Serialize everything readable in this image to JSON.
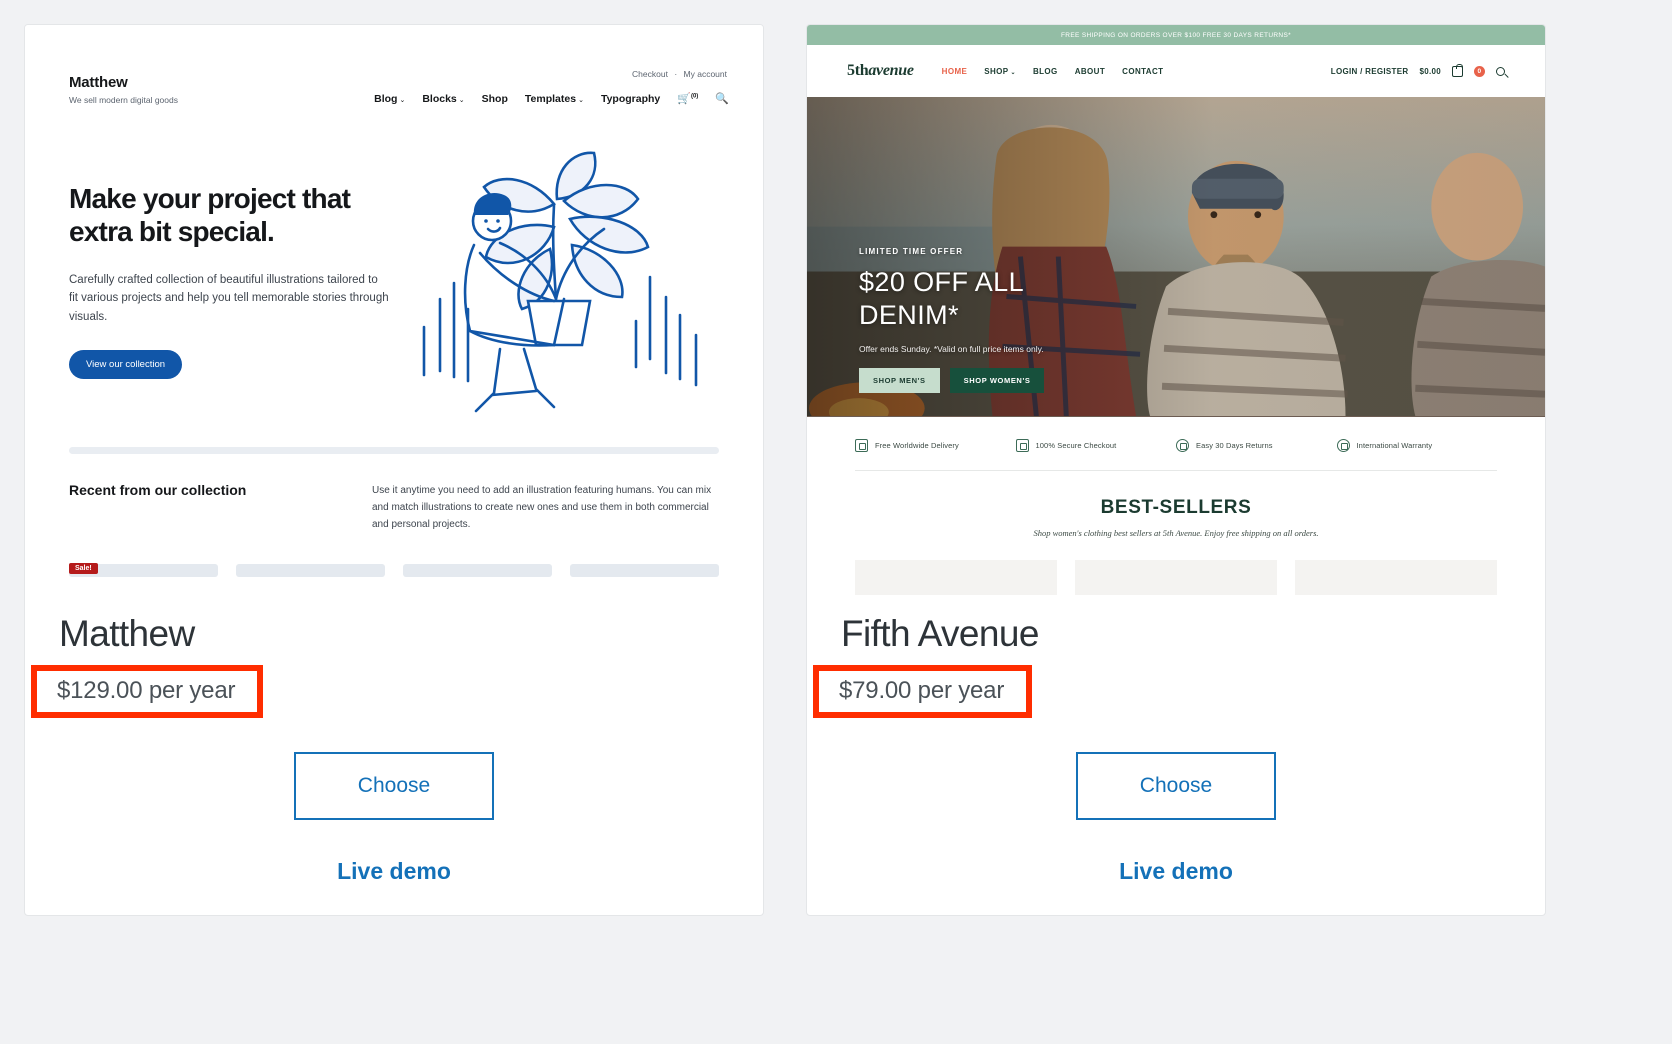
{
  "products": [
    {
      "name": "Matthew",
      "price": "$129.00 per year",
      "choose_label": "Choose",
      "demo_label": "Live demo",
      "preview": {
        "brand": "Matthew",
        "tagline": "We sell modern digital goods",
        "utility_links": [
          "Checkout",
          "My account"
        ],
        "utility_separator": "·",
        "nav": [
          {
            "label": "Blog",
            "caret": "⌄"
          },
          {
            "label": "Blocks",
            "caret": "⌄"
          },
          {
            "label": "Shop",
            "caret": ""
          },
          {
            "label": "Templates",
            "caret": "⌄"
          },
          {
            "label": "Typography",
            "caret": ""
          }
        ],
        "cart_icon": "cart-icon",
        "cart_count": "(0)",
        "search_icon": "search-icon",
        "heading": "Make your project that extra bit special.",
        "body": "Carefully crafted collection of beautiful illustrations tailored to fit various projects and help you tell memorable stories through visuals.",
        "cta": "View our collection",
        "collection_title": "Recent from our collection",
        "collection_text": "Use it anytime you need to add an illustration featuring humans. You can mix and match illustrations to create new ones and use them in both commercial and personal projects.",
        "sale_badge": "Sale!"
      }
    },
    {
      "name": "Fifth Avenue",
      "price": "$79.00 per year",
      "choose_label": "Choose",
      "demo_label": "Live demo",
      "preview": {
        "announcement": "FREE SHIPPING ON ORDERS OVER $100 FREE 30 DAYS RETURNS*",
        "logo_prefix": "5th",
        "logo_suffix": "avenue",
        "nav": [
          {
            "label": "HOME",
            "caret": "",
            "active": true
          },
          {
            "label": "SHOP",
            "caret": "⌄",
            "active": false
          },
          {
            "label": "BLOG",
            "caret": "",
            "active": false
          },
          {
            "label": "ABOUT",
            "caret": "",
            "active": false
          },
          {
            "label": "CONTACT",
            "caret": "",
            "active": false
          }
        ],
        "login": "LOGIN / REGISTER",
        "cart_total": "$0.00",
        "cart_icon": "bag-icon",
        "cart_count": "0",
        "search_icon": "search-icon",
        "hero_kicker": "LIMITED TIME OFFER",
        "hero_heading_line1": "$20 OFF ALL",
        "hero_heading_line2": "DENIM*",
        "hero_sub": "Offer ends Sunday.  *Valid on full price items only.",
        "cta_men": "SHOP MEN'S",
        "cta_women": "SHOP WOMEN'S",
        "features": [
          {
            "icon": "box-icon",
            "label": "Free Worldwide Delivery"
          },
          {
            "icon": "lock-icon",
            "label": "100% Secure Checkout"
          },
          {
            "icon": "return-icon",
            "label": "Easy 30 Days Returns"
          },
          {
            "icon": "globe-icon",
            "label": "International Warranty"
          }
        ],
        "best_title": "BEST-SELLERS",
        "best_sub": "Shop women's clothing best sellers at 5th Avenue. Enjoy free shipping on all orders."
      }
    }
  ],
  "colors": {
    "highlight": "#ff2d00",
    "link": "#1471b8",
    "matthew_accent": "#1156a8",
    "fifth_green": "#1b3b30",
    "fifth_banner": "#93bda5",
    "fifth_orange": "#e8624a",
    "sale_badge": "#b51b1b"
  }
}
